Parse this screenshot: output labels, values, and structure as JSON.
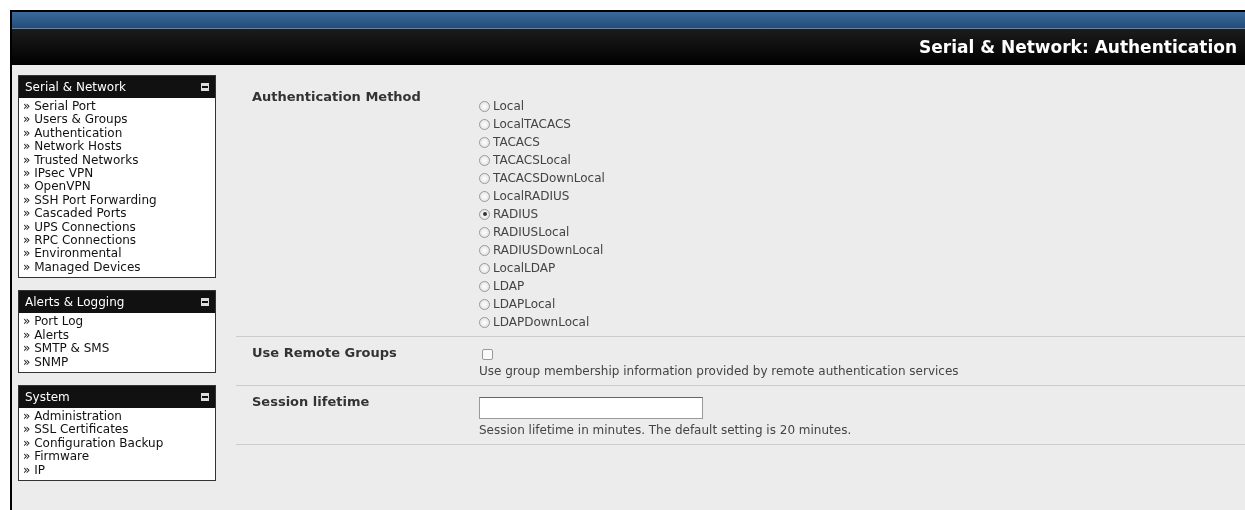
{
  "header": {
    "title": "Serial & Network: Authentication"
  },
  "sidebar": [
    {
      "title": "Serial & Network",
      "items": [
        "» Serial Port",
        "» Users & Groups",
        "» Authentication",
        "» Network Hosts",
        "» Trusted Networks",
        "» IPsec VPN",
        "» OpenVPN",
        "» SSH Port Forwarding",
        "» Cascaded Ports",
        "» UPS Connections",
        "» RPC Connections",
        "» Environmental",
        "» Managed Devices"
      ]
    },
    {
      "title": "Alerts & Logging",
      "items": [
        "» Port Log",
        "» Alerts",
        "» SMTP & SMS",
        "» SNMP"
      ]
    },
    {
      "title": "System",
      "items": [
        "» Administration",
        "» SSL Certificates",
        "» Configuration Backup",
        "» Firmware",
        "» IP"
      ]
    }
  ],
  "settings": [
    {
      "kind": "radio",
      "label": "Authentication Method",
      "options": [
        {
          "label": "Local",
          "selected": false
        },
        {
          "label": "LocalTACACS",
          "selected": false
        },
        {
          "label": "TACACS",
          "selected": false
        },
        {
          "label": "TACACSLocal",
          "selected": false
        },
        {
          "label": "TACACSDownLocal",
          "selected": false
        },
        {
          "label": "LocalRADIUS",
          "selected": false
        },
        {
          "label": "RADIUS",
          "selected": true
        },
        {
          "label": "RADIUSLocal",
          "selected": false
        },
        {
          "label": "RADIUSDownLocal",
          "selected": false
        },
        {
          "label": "LocalLDAP",
          "selected": false
        },
        {
          "label": "LDAP",
          "selected": false
        },
        {
          "label": "LDAPLocal",
          "selected": false
        },
        {
          "label": "LDAPDownLocal",
          "selected": false
        }
      ]
    },
    {
      "kind": "checkbox",
      "label": "Use Remote Groups",
      "checked": false,
      "help": "Use group membership information provided by remote authentication services"
    },
    {
      "kind": "text",
      "label": "Session lifetime",
      "help": "Session lifetime in minutes. The default setting is 20 minutes."
    }
  ]
}
